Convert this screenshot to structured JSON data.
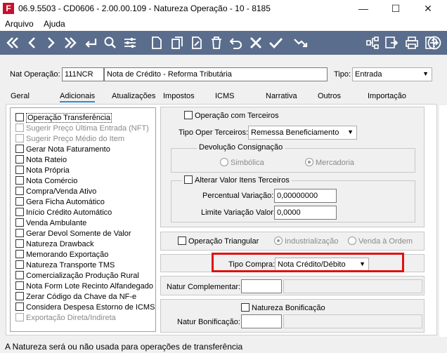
{
  "window": {
    "title": "06.9.5503 - CD0606 - 2.00.00.109 - Natureza Operação - 10 - 8185",
    "app_icon_letter": "F",
    "minimize": "—",
    "maximize": "☐",
    "close": "✕"
  },
  "menu": {
    "items": [
      "Arquivo",
      "Ajuda"
    ]
  },
  "toolbar": {
    "left_icons": [
      "first-icon",
      "previous-icon",
      "next-icon",
      "last-icon",
      "return-icon",
      "search-icon",
      "filter-icon",
      "new-icon",
      "copy-icon",
      "edit-icon",
      "delete-icon",
      "undo-icon",
      "cancel-icon",
      "confirm-icon",
      "chart-icon"
    ],
    "right_icons": [
      "structure-icon",
      "export-icon",
      "print-icon",
      "exit-icon",
      "help-icon"
    ]
  },
  "header": {
    "nat_label": "Nat Operação:",
    "nat_code": "111NCR",
    "nat_description": "Nota de Crédito - Reforma Tributária",
    "tipo_label": "Tipo:",
    "tipo_value": "Entrada"
  },
  "tabs": [
    "Geral",
    "Adicionais",
    "Atualizações",
    "Impostos",
    "ICMS",
    "Narrativa",
    "Outros",
    "Importação"
  ],
  "active_tab": "Adicionais",
  "checklist": [
    {
      "label": "Operação Transferência",
      "enabled": true
    },
    {
      "label": "Sugerir Preço Última Entrada (NFT)",
      "enabled": false
    },
    {
      "label": "Sugerir Preço Médio do Item",
      "enabled": false
    },
    {
      "label": "Gerar Nota Faturamento",
      "enabled": true
    },
    {
      "label": "Nota Rateio",
      "enabled": true
    },
    {
      "label": "Nota Própria",
      "enabled": true
    },
    {
      "label": "Nota Comércio",
      "enabled": true
    },
    {
      "label": "Compra/Venda Ativo",
      "enabled": true
    },
    {
      "label": "Gera Ficha Automático",
      "enabled": true
    },
    {
      "label": "Início Crédito Automático",
      "enabled": true
    },
    {
      "label": "Venda Ambulante",
      "enabled": true
    },
    {
      "label": "Gerar Devol Somente de Valor",
      "enabled": true
    },
    {
      "label": "Natureza Drawback",
      "enabled": true
    },
    {
      "label": "Memorando Exportação",
      "enabled": true
    },
    {
      "label": "Natureza Transporte TMS",
      "enabled": true
    },
    {
      "label": "Comercialização Produção Rural",
      "enabled": true
    },
    {
      "label": "Nota Form Lote Recinto Alfandegado",
      "enabled": true
    },
    {
      "label": "Zerar Código da Chave da NF-e",
      "enabled": true
    },
    {
      "label": "Considera Despesa Estorno de ICMS",
      "enabled": true
    },
    {
      "label": "Exportação Direta/Indireta",
      "enabled": false
    }
  ],
  "terceiros": {
    "operacao_label": "Operação com Terceiros",
    "tipo_oper_label": "Tipo Oper Terceiros:",
    "tipo_oper_value": "Remessa Beneficiamento",
    "devolucao_title": "Devolução Consignação",
    "simbolica": "Simbólica",
    "mercadoria": "Mercadoria",
    "alterar_label": "Alterar Valor Itens Terceiros",
    "percentual_label": "Percentual Variação:",
    "percentual_value": "0,00000000",
    "limite_label": "Limite Variação Valor:",
    "limite_value": "0,0000"
  },
  "triangular": {
    "label": "Operação Triangular",
    "industrializacao": "Industrialização",
    "venda_ordem": "Venda à Ordem"
  },
  "compra": {
    "label": "Tipo Compra:",
    "value": "Nota Crédito/Débito"
  },
  "complementar": {
    "label": "Natur Complementar:",
    "code": "",
    "description": ""
  },
  "bonificacao": {
    "checkbox_label": "Natureza Bonificação",
    "label": "Natur Bonificação:",
    "code": "",
    "description": ""
  },
  "status": {
    "text": "A Natureza será ou não usada para operações de transferência"
  },
  "colors": {
    "toolbar": "#5a6d8c",
    "highlight": "#e01010",
    "tab_underline": "#2c8cd6"
  }
}
